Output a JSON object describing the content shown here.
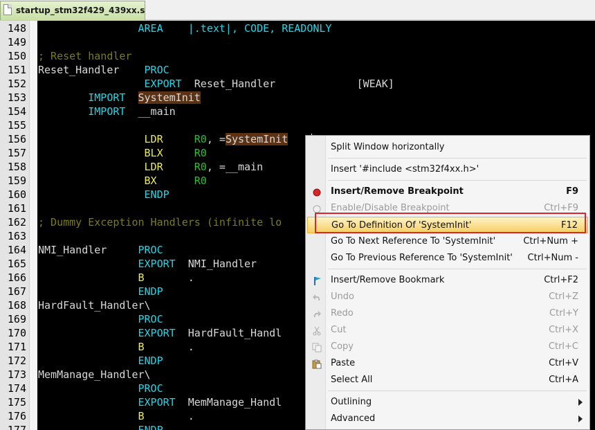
{
  "tab": {
    "title": "startup_stm32f429_439xx.s"
  },
  "code_lines": [
    {
      "n": "148",
      "segs": [
        {
          "t": "                "
        },
        {
          "t": "AREA",
          "c": "kw"
        },
        {
          "t": "    "
        },
        {
          "t": "|.text|, CODE, READONLY",
          "c": "kw"
        }
      ]
    },
    {
      "n": "149",
      "segs": []
    },
    {
      "n": "150",
      "segs": [
        {
          "t": "; Reset handler",
          "c": "cm"
        }
      ]
    },
    {
      "n": "151",
      "segs": [
        {
          "t": "Reset_Handler",
          "c": "id"
        },
        {
          "t": "    "
        },
        {
          "t": "PROC",
          "c": "kw"
        }
      ]
    },
    {
      "n": "152",
      "segs": [
        {
          "t": "                 "
        },
        {
          "t": "EXPORT",
          "c": "kw"
        },
        {
          "t": "  "
        },
        {
          "t": "Reset_Handler",
          "c": "id"
        },
        {
          "t": "             "
        },
        {
          "t": "[WEAK]",
          "c": "id"
        }
      ]
    },
    {
      "n": "153",
      "segs": [
        {
          "t": "        "
        },
        {
          "t": "IMPORT",
          "c": "kw"
        },
        {
          "t": "  "
        },
        {
          "t": "SystemInit",
          "c": "id",
          "hl": true
        }
      ]
    },
    {
      "n": "154",
      "segs": [
        {
          "t": "        "
        },
        {
          "t": "IMPORT",
          "c": "kw"
        },
        {
          "t": "  "
        },
        {
          "t": "__main",
          "c": "id"
        }
      ]
    },
    {
      "n": "155",
      "segs": []
    },
    {
      "n": "156",
      "segs": [
        {
          "t": "                 "
        },
        {
          "t": "LDR",
          "c": "ins"
        },
        {
          "t": "     "
        },
        {
          "t": "R0",
          "c": "reg"
        },
        {
          "t": ", =",
          "c": "id"
        },
        {
          "t": "SystemInit",
          "c": "id",
          "hl": true
        }
      ]
    },
    {
      "n": "157",
      "segs": [
        {
          "t": "                 "
        },
        {
          "t": "BLX",
          "c": "ins"
        },
        {
          "t": "     "
        },
        {
          "t": "R0",
          "c": "reg"
        }
      ]
    },
    {
      "n": "158",
      "segs": [
        {
          "t": "                 "
        },
        {
          "t": "LDR",
          "c": "ins"
        },
        {
          "t": "     "
        },
        {
          "t": "R0",
          "c": "reg"
        },
        {
          "t": ", =__main",
          "c": "id"
        }
      ]
    },
    {
      "n": "159",
      "segs": [
        {
          "t": "                 "
        },
        {
          "t": "BX",
          "c": "ins"
        },
        {
          "t": "      "
        },
        {
          "t": "R0",
          "c": "reg"
        }
      ]
    },
    {
      "n": "160",
      "segs": [
        {
          "t": "                 "
        },
        {
          "t": "ENDP",
          "c": "kw"
        }
      ]
    },
    {
      "n": "161",
      "segs": []
    },
    {
      "n": "162",
      "segs": [
        {
          "t": "; Dummy Exception Handlers (infinite lo",
          "c": "cm"
        }
      ]
    },
    {
      "n": "163",
      "segs": []
    },
    {
      "n": "164",
      "segs": [
        {
          "t": "NMI_Handler",
          "c": "id"
        },
        {
          "t": "     "
        },
        {
          "t": "PROC",
          "c": "kw"
        }
      ]
    },
    {
      "n": "165",
      "segs": [
        {
          "t": "                "
        },
        {
          "t": "EXPORT",
          "c": "kw"
        },
        {
          "t": "  "
        },
        {
          "t": "NMI_Handler",
          "c": "id"
        }
      ]
    },
    {
      "n": "166",
      "segs": [
        {
          "t": "                "
        },
        {
          "t": "B",
          "c": "ins"
        },
        {
          "t": "       "
        },
        {
          "t": ".",
          "c": "id"
        }
      ]
    },
    {
      "n": "167",
      "segs": [
        {
          "t": "                "
        },
        {
          "t": "ENDP",
          "c": "kw"
        }
      ]
    },
    {
      "n": "168",
      "segs": [
        {
          "t": "HardFault_Handler\\",
          "c": "id"
        }
      ]
    },
    {
      "n": "169",
      "segs": [
        {
          "t": "                "
        },
        {
          "t": "PROC",
          "c": "kw"
        }
      ]
    },
    {
      "n": "170",
      "segs": [
        {
          "t": "                "
        },
        {
          "t": "EXPORT",
          "c": "kw"
        },
        {
          "t": "  "
        },
        {
          "t": "HardFault_Handl",
          "c": "id"
        }
      ]
    },
    {
      "n": "171",
      "segs": [
        {
          "t": "                "
        },
        {
          "t": "B",
          "c": "ins"
        },
        {
          "t": "       "
        },
        {
          "t": ".",
          "c": "id"
        }
      ]
    },
    {
      "n": "172",
      "segs": [
        {
          "t": "                "
        },
        {
          "t": "ENDP",
          "c": "kw"
        }
      ]
    },
    {
      "n": "173",
      "segs": [
        {
          "t": "MemManage_Handler\\",
          "c": "id"
        }
      ]
    },
    {
      "n": "174",
      "segs": [
        {
          "t": "                "
        },
        {
          "t": "PROC",
          "c": "kw"
        }
      ]
    },
    {
      "n": "175",
      "segs": [
        {
          "t": "                "
        },
        {
          "t": "EXPORT",
          "c": "kw"
        },
        {
          "t": "  "
        },
        {
          "t": "MemManage_Handl",
          "c": "id"
        }
      ]
    },
    {
      "n": "176",
      "segs": [
        {
          "t": "                "
        },
        {
          "t": "B",
          "c": "ins"
        },
        {
          "t": "       "
        },
        {
          "t": ".",
          "c": "id"
        }
      ]
    },
    {
      "n": "177",
      "segs": [
        {
          "t": "                "
        },
        {
          "t": "ENDP",
          "c": "kw"
        }
      ]
    }
  ],
  "syntax_colors": {
    "kw": "#1fd7e8",
    "ins": "#ecec58",
    "reg": "#2fbf35",
    "cm": "#7c7c18",
    "id": "#d8d8d8"
  },
  "context_menu": {
    "items": [
      {
        "label": "Split Window horizontally",
        "key": ""
      },
      {
        "sep": true
      },
      {
        "label": "Insert '#include <stm32f4xx.h>'",
        "key": ""
      },
      {
        "sep": true
      },
      {
        "label": "Insert/Remove Breakpoint",
        "key": "F9",
        "bold": true,
        "icon": "breakpoint-icon"
      },
      {
        "label": "Enable/Disable Breakpoint",
        "key": "Ctrl+F9",
        "disabled": true,
        "icon": "breakpoint-disabled-icon"
      },
      {
        "label": "Go To Definition Of 'SystemInit'",
        "key": "F12",
        "selected": true
      },
      {
        "label": "Go To Next Reference To 'SystemInit'",
        "key": "Ctrl+Num +"
      },
      {
        "label": "Go To Previous Reference To 'SystemInit'",
        "key": "Ctrl+Num -"
      },
      {
        "sep": true
      },
      {
        "label": "Insert/Remove Bookmark",
        "key": "Ctrl+F2",
        "icon": "bookmark-icon"
      },
      {
        "label": "Undo",
        "key": "Ctrl+Z",
        "disabled": true,
        "icon": "undo-icon"
      },
      {
        "label": "Redo",
        "key": "Ctrl+Y",
        "disabled": true,
        "icon": "redo-icon"
      },
      {
        "label": "Cut",
        "key": "Ctrl+X",
        "disabled": true,
        "icon": "cut-icon"
      },
      {
        "label": "Copy",
        "key": "Ctrl+C",
        "disabled": true,
        "icon": "copy-icon"
      },
      {
        "label": "Paste",
        "key": "Ctrl+V",
        "icon": "paste-icon"
      },
      {
        "label": "Select All",
        "key": "Ctrl+A"
      },
      {
        "sep": true
      },
      {
        "label": "Outlining",
        "key": "",
        "submenu": true
      },
      {
        "label": "Advanced",
        "key": "",
        "submenu": true
      }
    ]
  },
  "colors": {
    "highlight_annotation": "#e0242a",
    "menu_selected": "#f6cf63"
  }
}
